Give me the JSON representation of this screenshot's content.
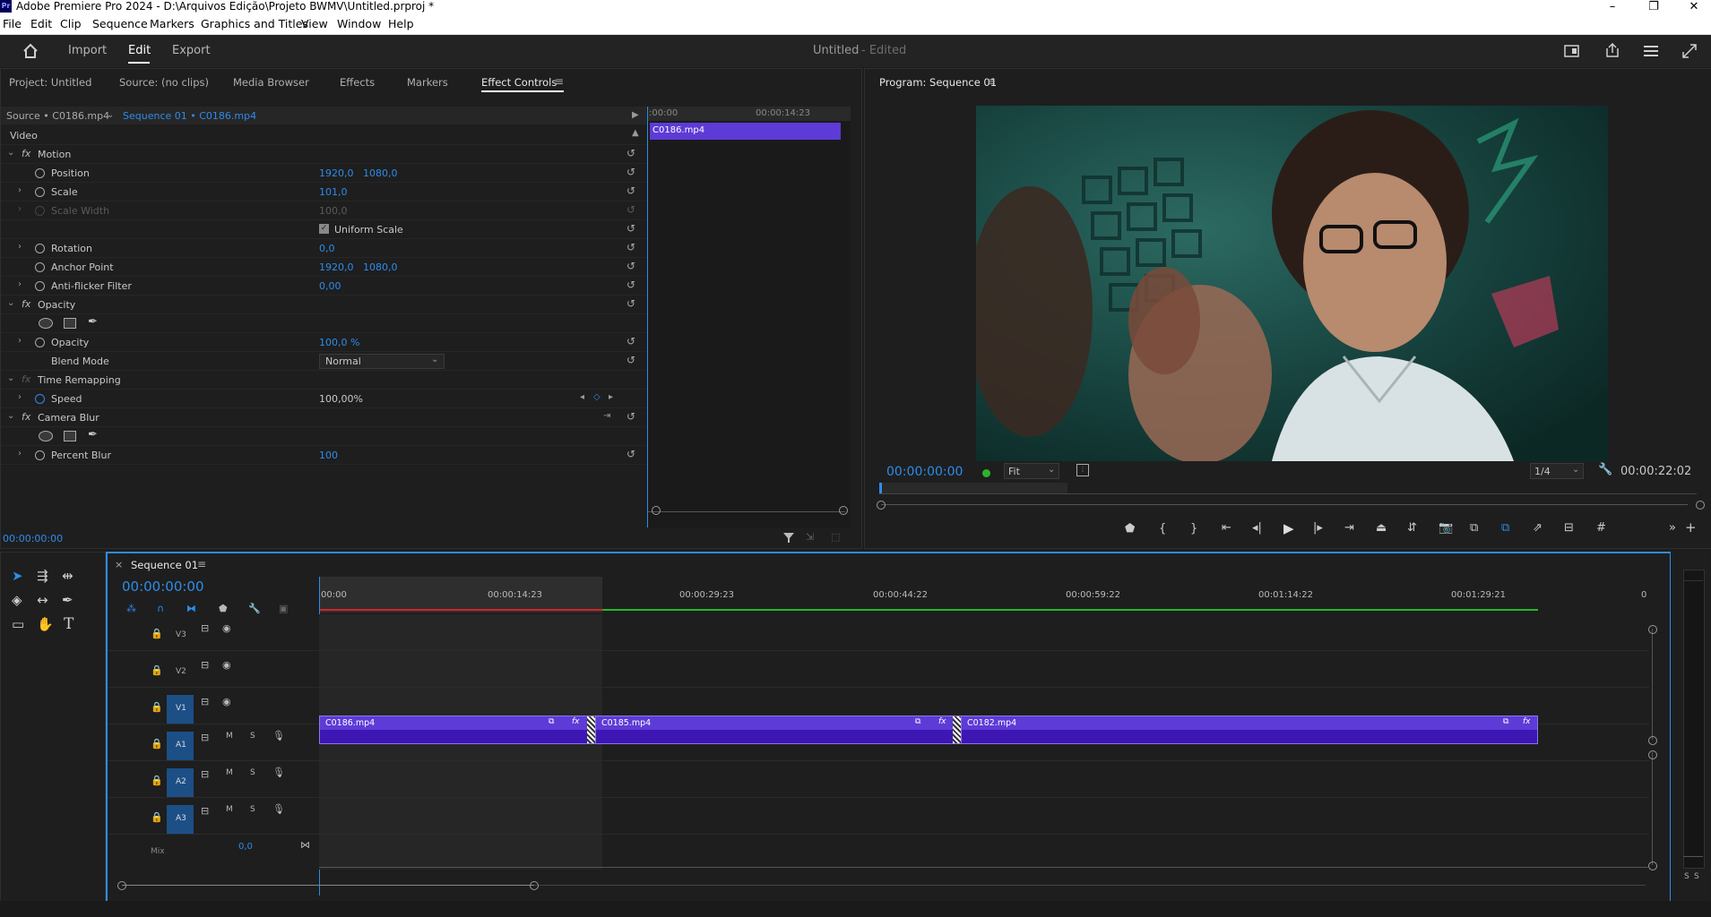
{
  "window": {
    "title": "Adobe Premiere Pro 2024 - D:\\Arquivos Edição\\Projeto BWMV\\Untitled.prproj *",
    "logo": "Pr",
    "controls": {
      "minimize": "–",
      "maximize": "❐",
      "close": "✕"
    }
  },
  "menu": [
    "File",
    "Edit",
    "Clip",
    "Sequence",
    "Markers",
    "Graphics and Titles",
    "View",
    "Window",
    "Help"
  ],
  "workspace": {
    "tabs": [
      "Import",
      "Edit",
      "Export"
    ],
    "active_tab": "Edit",
    "doc_title": "Untitled",
    "doc_status": "- Edited"
  },
  "top_left_panel": {
    "tabs": [
      "Project: Untitled",
      "Source: (no clips)",
      "Media Browser",
      "Effects",
      "Markers",
      "Effect Controls"
    ],
    "active_tab": "Effect Controls",
    "source_label": "Source • C0186.mp4",
    "sequence_label": "Sequence 01 • C0186.mp4",
    "section_video": "Video",
    "mini_timeline": {
      "start": ":00:00",
      "mid": "00:00:14:23",
      "clip": "C0186.mp4"
    },
    "effects": {
      "motion": "Motion",
      "position": {
        "label": "Position",
        "x": "1920,0",
        "y": "1080,0"
      },
      "scale": {
        "label": "Scale",
        "value": "101,0"
      },
      "scale_width": {
        "label": "Scale Width",
        "value": "100,0"
      },
      "uniform_scale": "Uniform Scale",
      "rotation": {
        "label": "Rotation",
        "value": "0,0"
      },
      "anchor_point": {
        "label": "Anchor Point",
        "x": "1920,0",
        "y": "1080,0"
      },
      "anti_flicker": {
        "label": "Anti-flicker Filter",
        "value": "0,00"
      },
      "opacity_group": "Opacity",
      "opacity": {
        "label": "Opacity",
        "value": "100,0 %"
      },
      "blend_mode": {
        "label": "Blend Mode",
        "value": "Normal"
      },
      "time_remapping": "Time Remapping",
      "speed": {
        "label": "Speed",
        "value": "100,00%"
      },
      "camera_blur": "Camera Blur",
      "percent_blur": {
        "label": "Percent Blur",
        "value": "100"
      }
    },
    "footer_time": "00:00:00:00"
  },
  "program_monitor": {
    "title": "Program: Sequence 01",
    "timecode": "00:00:00:00",
    "fit": "Fit",
    "resolution": "1/4",
    "duration": "00:00:22:02"
  },
  "timeline": {
    "sequence_tab": "Sequence 01",
    "timecode": "00:00:00:00",
    "ruler": [
      "00:00",
      "00:00:14:23",
      "00:00:29:23",
      "00:00:44:22",
      "00:00:59:22",
      "00:01:14:22",
      "00:01:29:21",
      "0"
    ],
    "video_tracks": [
      "V3",
      "V2",
      "V1"
    ],
    "audio_tracks": [
      "A1",
      "A2",
      "A3"
    ],
    "audio_buttons": {
      "mute": "M",
      "solo": "S"
    },
    "mix_label": "Mix",
    "mix_value": "0,0",
    "clips": [
      "C0186.mp4",
      "C0185.mp4",
      "C0182.mp4"
    ],
    "clip_fx": "fx"
  },
  "audio_meter": {
    "labels": [
      "S",
      "S"
    ]
  },
  "colors": {
    "accent": "#2d8ceb",
    "clip": "#5d3bd6",
    "clip_dark": "#3d16b3",
    "playhead": "#2d8ceb",
    "timeline_red": "#d42424",
    "timeline_green": "#2bb52b"
  },
  "icons": [
    "home-icon",
    "workspaces-icon",
    "share-icon",
    "menu-icon",
    "fullscreen-icon",
    "selection-tool-icon",
    "track-select-icon",
    "ripple-edit-icon",
    "razor-icon",
    "slip-icon",
    "pen-icon",
    "rectangle-icon",
    "hand-icon",
    "type-icon",
    "play-icon",
    "step-back-icon",
    "step-forward-icon",
    "camera-icon",
    "wrench-icon",
    "filter-icon",
    "lock-icon",
    "eye-icon",
    "mic-icon"
  ]
}
